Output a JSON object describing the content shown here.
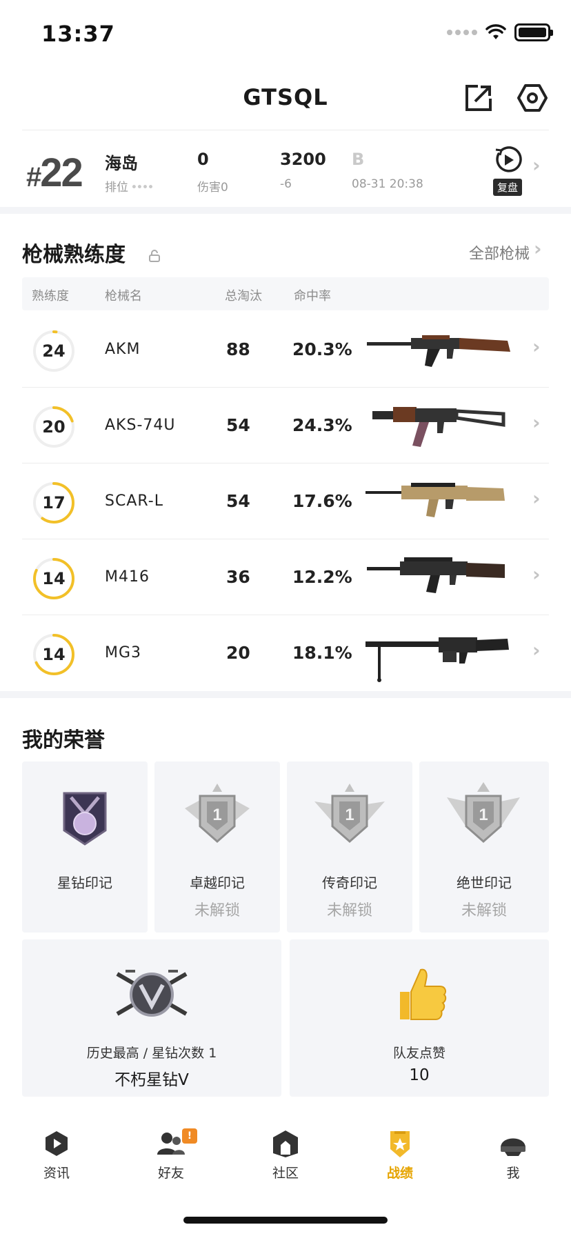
{
  "status_bar": {
    "time": "13:37"
  },
  "header": {
    "title": "GTSQL",
    "icons": [
      "share-icon",
      "settings-hex-icon"
    ]
  },
  "match": {
    "rank_prefix": "#",
    "rank_number": "22",
    "map": "海岛",
    "mode": "排位",
    "kills": "0",
    "damage_label": "伤害0",
    "score": "3200",
    "score_change": "-6",
    "grade": "B",
    "datetime": "08-31 20:38",
    "replay_label": "复盘"
  },
  "weapons_section": {
    "title": "枪械熟练度",
    "all_link": "全部枪械",
    "columns": [
      "熟练度",
      "枪械名",
      "总淘汰",
      "命中率"
    ],
    "rows": [
      {
        "level": "24",
        "progress": 0.02,
        "name": "AKM",
        "kills": "88",
        "accuracy": "20.3%"
      },
      {
        "level": "20",
        "progress": 0.2,
        "name": "AKS-74U",
        "kills": "54",
        "accuracy": "24.3%"
      },
      {
        "level": "17",
        "progress": 0.6,
        "name": "SCAR-L",
        "kills": "54",
        "accuracy": "17.6%"
      },
      {
        "level": "14",
        "progress": 0.82,
        "name": "M416",
        "kills": "36",
        "accuracy": "12.2%"
      },
      {
        "level": "14",
        "progress": 0.68,
        "name": "MG3",
        "kills": "20",
        "accuracy": "18.1%"
      }
    ]
  },
  "honor_section": {
    "title": "我的荣誉",
    "badges": [
      {
        "name": "星钻印记",
        "status": ""
      },
      {
        "name": "卓越印记",
        "status": "未解锁"
      },
      {
        "name": "传奇印记",
        "status": "未解锁"
      },
      {
        "name": "绝世印记",
        "status": "未解锁"
      }
    ],
    "cards": [
      {
        "label": "历史最高 / 星钻次数 1",
        "value": "不朽星钻Ⅴ"
      },
      {
        "label": "队友点赞",
        "value": "10"
      }
    ]
  },
  "tab_bar": {
    "tabs": [
      {
        "label": "资讯",
        "active": false
      },
      {
        "label": "好友",
        "active": false,
        "badge": "!"
      },
      {
        "label": "社区",
        "active": false
      },
      {
        "label": "战绩",
        "active": true
      },
      {
        "label": "我",
        "active": false
      }
    ]
  },
  "colors": {
    "accent": "#f2c028",
    "active_tab": "#e6a400",
    "badge": "#f08a24"
  }
}
